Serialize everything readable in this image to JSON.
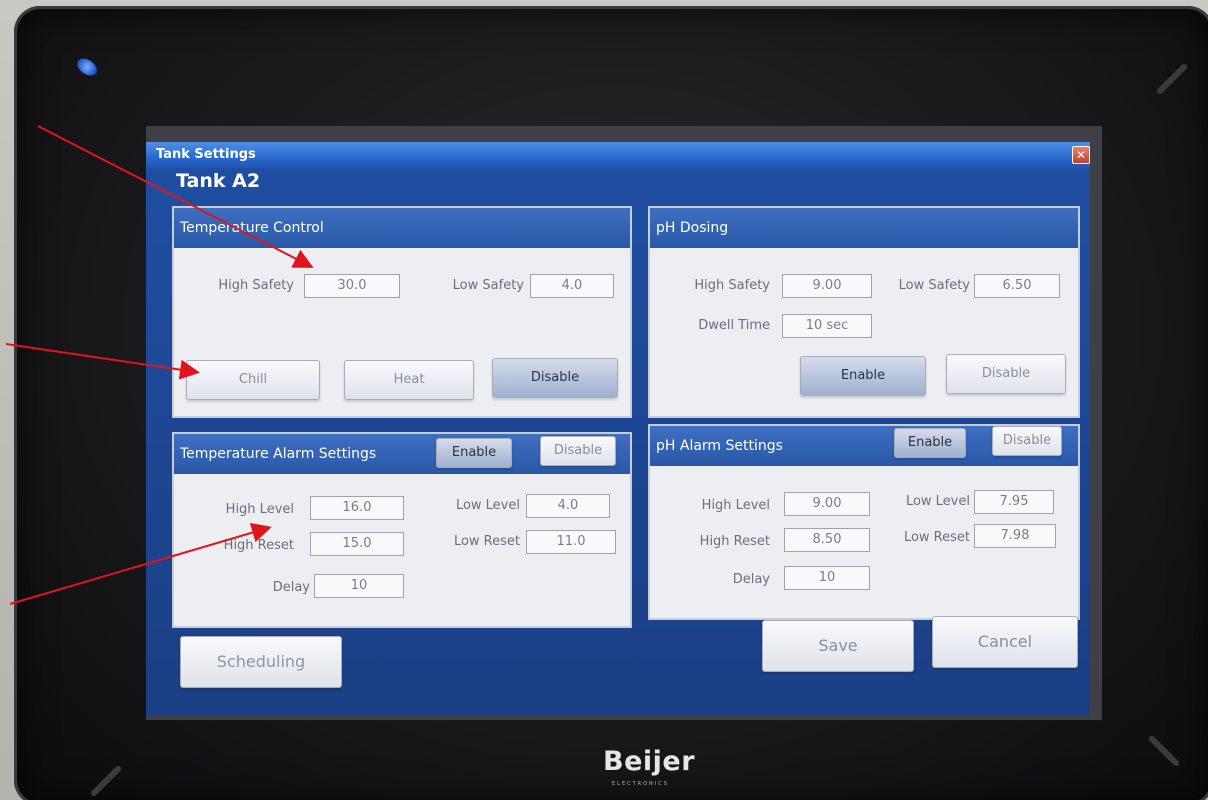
{
  "window": {
    "title": "Tank Settings",
    "close_glyph": "✕"
  },
  "tank_title": "Tank A2",
  "temperature_control": {
    "heading": "Temperature Control",
    "high_safety_label": "High Safety",
    "high_safety_value": "30.0",
    "low_safety_label": "Low Safety",
    "low_safety_value": "4.0",
    "buttons": {
      "chill": "Chill",
      "heat": "Heat",
      "disable": "Disable"
    }
  },
  "ph_dosing": {
    "heading": "pH Dosing",
    "high_safety_label": "High Safety",
    "high_safety_value": "9.00",
    "low_safety_label": "Low Safety",
    "low_safety_value": "6.50",
    "dwell_label": "Dwell Time",
    "dwell_value": "10 sec",
    "buttons": {
      "enable": "Enable",
      "disable": "Disable"
    }
  },
  "temp_alarm": {
    "heading": "Temperature Alarm Settings",
    "enable": "Enable",
    "disable": "Disable",
    "high_level_label": "High Level",
    "high_level_value": "16.0",
    "low_level_label": "Low Level",
    "low_level_value": "4.0",
    "high_reset_label": "High Reset",
    "high_reset_value": "15.0",
    "low_reset_label": "Low Reset",
    "low_reset_value": "11.0",
    "delay_label": "Delay",
    "delay_value": "10"
  },
  "ph_alarm": {
    "heading": "pH Alarm Settings",
    "enable": "Enable",
    "disable": "Disable",
    "high_level_label": "High Level",
    "high_level_value": "9.00",
    "low_level_label": "Low Level",
    "low_level_value": "7.95",
    "high_reset_label": "High Reset",
    "high_reset_value": "8.50",
    "low_reset_label": "Low Reset",
    "low_reset_value": "7.98",
    "delay_label": "Delay",
    "delay_value": "10"
  },
  "footer": {
    "scheduling": "Scheduling",
    "save": "Save",
    "cancel": "Cancel"
  },
  "device": {
    "brand": "Beijer",
    "brand_sub": "ELECTRONICS"
  },
  "colors": {
    "annotation_arrow": "#e0151b",
    "title_bar": "#2c6cd0",
    "panel_header": "#2a58a8"
  }
}
